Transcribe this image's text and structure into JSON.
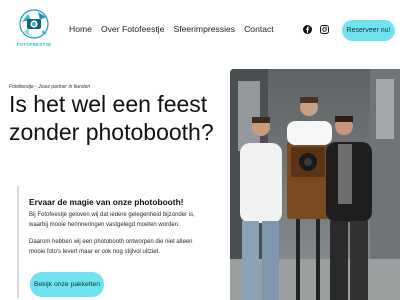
{
  "header": {
    "logo_text": "FOTOFEESTJE",
    "nav": [
      "Home",
      "Over Fotofeestje",
      "Sfeerimpressies",
      "Contact"
    ],
    "social_icons": [
      "facebook-icon",
      "instagram-icon"
    ],
    "reserve_label": "Reserveer nu!"
  },
  "hero": {
    "breadcrumb": "Fotofeestje - Jouw partner in feesten",
    "title": "Is het wel een feest zonder photobooth?",
    "subtitle": "Ervaar de magie van onze photobooth!",
    "paragraph1": "Bij Fotofeestje geloven wij dat iedere gelegenheid bijzonder is, waarbij mooie herinneringen vastgelegd moeten worden.",
    "paragraph2": "Daarom hebben wij een photobooth ontworpen die niet alleen mooie foto's levert maar er ook nog stijlvol uitziet.",
    "cta_label": "Bekijk onze pakketten"
  },
  "colors": {
    "accent": "#6fe3f0",
    "brand": "#25b9d6"
  }
}
